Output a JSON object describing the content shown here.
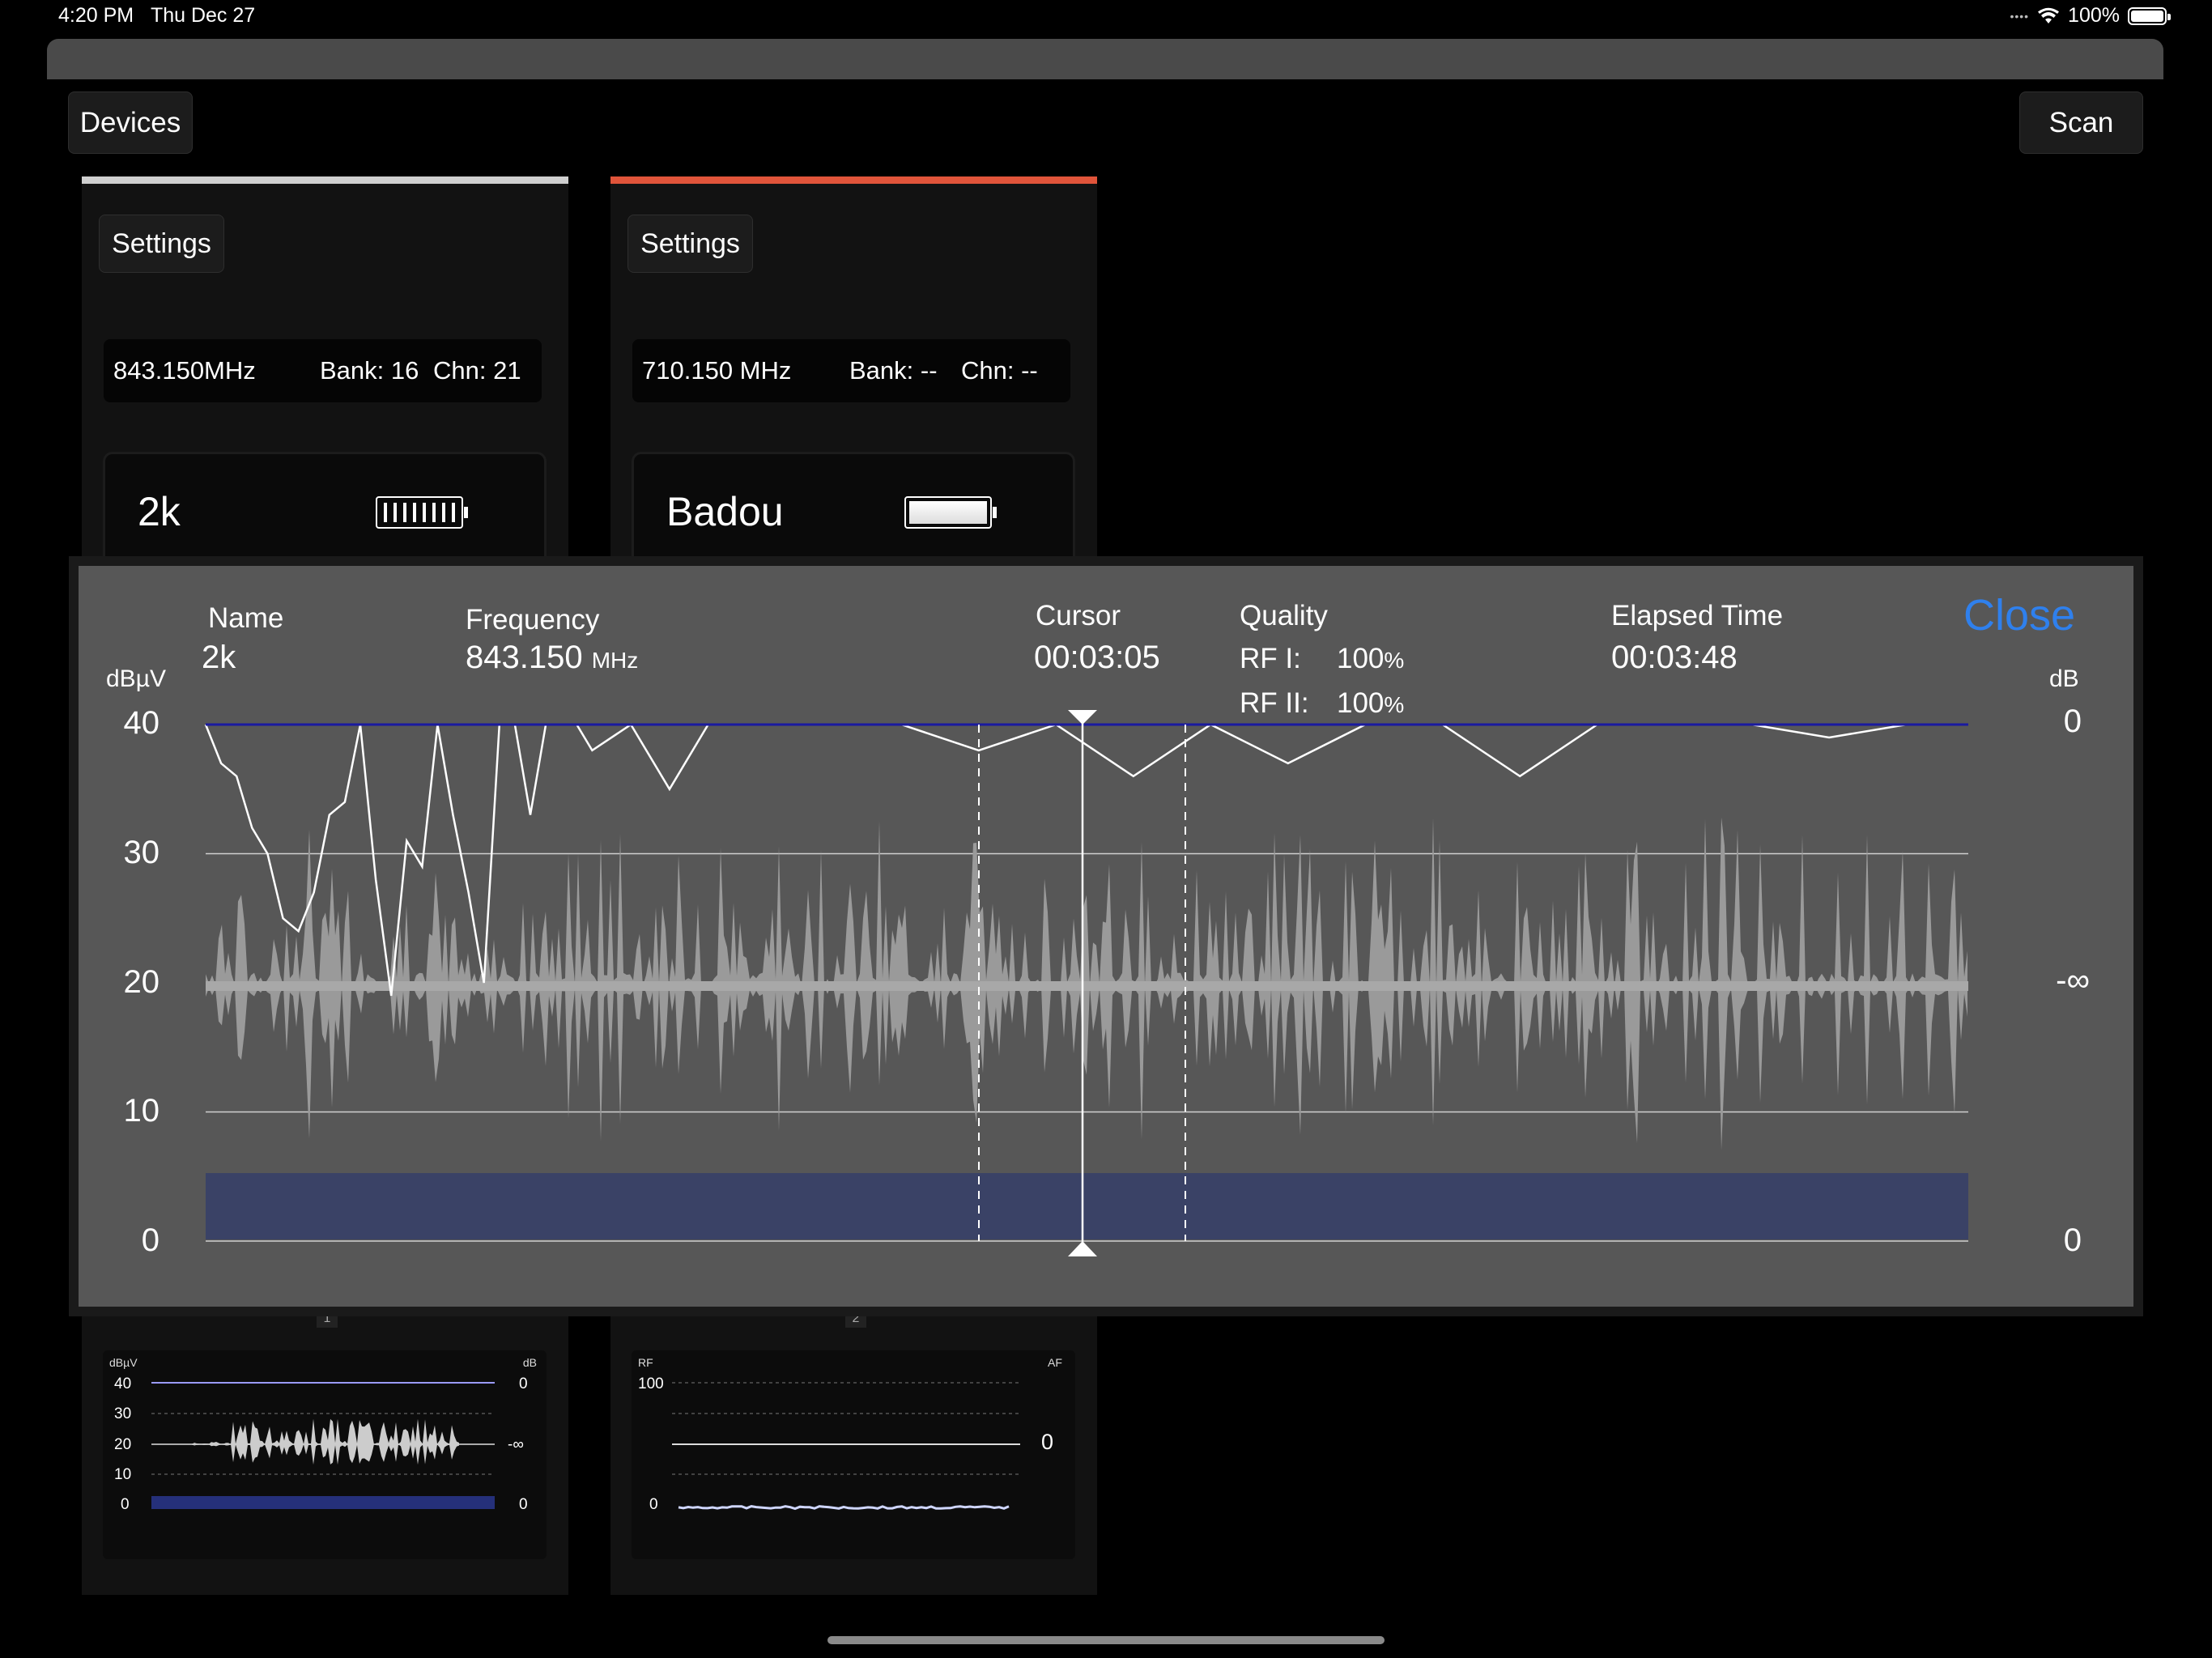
{
  "status_bar": {
    "time": "4:20 PM",
    "date": "Thu Dec 27",
    "battery": "100%",
    "icons": [
      "dots-icon",
      "wifi-icon",
      "battery-icon"
    ]
  },
  "toolbar": {
    "devices_label": "Devices",
    "scan_label": "Scan"
  },
  "devices": [
    {
      "settings_label": "Settings",
      "frequency": "843.150MHz",
      "bank": "Bank: 16",
      "channel": "Chn: 21",
      "name": "2k",
      "accent": "#cfcfcf",
      "index": "1",
      "mini_chart": {
        "left_unit": "dBµV",
        "right_unit": "dB",
        "left_ticks": [
          "40",
          "30",
          "20",
          "10",
          "0"
        ],
        "right_ticks": [
          "0",
          "-∞",
          "0"
        ]
      }
    },
    {
      "settings_label": "Settings",
      "frequency": "710.150 MHz",
      "bank": "Bank: --",
      "channel": "Chn: --",
      "name": "Badou",
      "accent": "#e0543a",
      "index": "2",
      "mini_chart": {
        "left_unit": "RF",
        "right_unit": "AF",
        "left_ticks": [
          "100",
          "0"
        ],
        "right_ticks": [
          "0"
        ]
      }
    }
  ],
  "detail": {
    "name_label": "Name",
    "name_value": "2k",
    "frequency_label": "Frequency",
    "frequency_value": "843.150",
    "frequency_unit": "MHz",
    "cursor_label": "Cursor",
    "cursor_value": "00:03:05",
    "quality_label": "Quality",
    "rf1_label": "RF I:",
    "rf1_value": "100",
    "rf2_label": "RF II:",
    "rf2_value": "100",
    "percent": "%",
    "elapsed_label": "Elapsed Time",
    "elapsed_value": "00:03:48",
    "close_label": "Close",
    "left_unit": "dBµV",
    "right_unit": "dB",
    "left_ticks": [
      "40",
      "30",
      "20",
      "10",
      "0"
    ],
    "right_ticks": [
      "0",
      "-∞",
      "0"
    ],
    "accent_color": "#2f80ed"
  },
  "chart_data": {
    "type": "line",
    "title": "",
    "xlabel": "",
    "ylabel": "dBµV",
    "y2label": "dB",
    "ylim": [
      0,
      40
    ],
    "y2_ticks": [
      "0",
      "-∞",
      "0"
    ],
    "x_range": [
      "00:00:00",
      "00:03:48"
    ],
    "cursor": "00:03:05",
    "series": [
      {
        "name": "",
        "type": "line",
        "t": [
          0,
          2,
          4,
          6,
          8,
          10,
          12,
          14,
          16,
          18,
          20,
          22,
          24,
          26,
          28,
          30,
          32,
          34,
          36,
          38,
          40,
          42,
          44,
          46,
          48,
          50,
          55,
          60,
          65,
          70,
          75,
          80,
          90,
          100,
          110,
          120,
          130,
          140,
          150,
          160,
          170,
          180,
          190,
          200,
          210,
          220,
          228
        ],
        "dbuv": [
          40,
          37,
          36,
          32,
          30,
          25,
          24,
          27,
          33,
          34,
          40,
          28,
          19,
          31,
          29,
          40,
          33,
          27,
          20,
          40,
          40,
          33,
          40,
          40,
          40,
          38,
          40,
          35,
          40,
          40,
          40,
          40,
          40,
          38,
          40,
          36,
          40,
          37,
          40,
          40,
          36,
          40,
          40,
          40,
          39,
          40,
          40
        ]
      }
    ],
    "af_level": "waveform around -∞ dB",
    "grid": true
  }
}
